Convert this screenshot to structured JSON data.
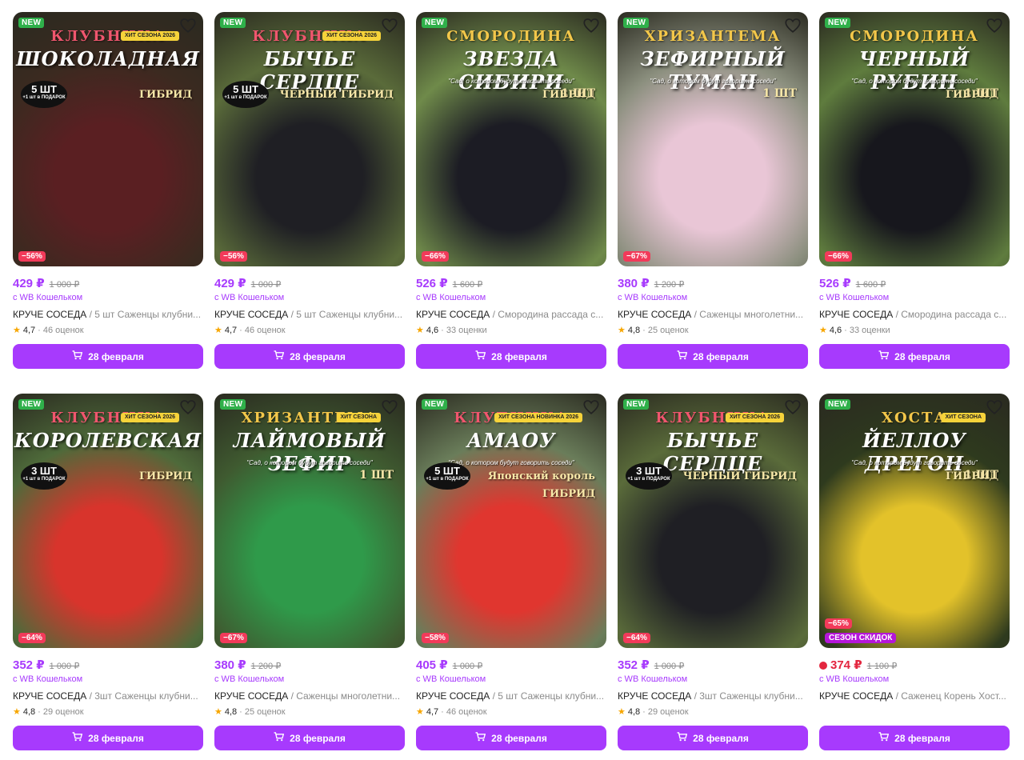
{
  "products": [
    {
      "new": "NEW",
      "cover_cat": "КЛУБНИКА",
      "cover_name": "ШОКОЛАДНАЯ",
      "cover_sub": "ГИБРИД",
      "cover_qty": "5 ШТ",
      "cover_qty_small": "+1 шт в ПОДАРОК",
      "cover_hit": "ХИТ СЕЗОНА 2026",
      "discount": "−56%",
      "price": "429 ₽",
      "old_price": "1 000 ₽",
      "wallet": "с WB Кошельком",
      "brand": "КРУЧЕ СОСЕДА",
      "name": " / 5 шт Саженцы клубни...",
      "rating": "4,7",
      "reviews": "· 46 оценок",
      "button": "28 февраля",
      "bg": "#3b2a20",
      "accent": "#5a1f22"
    },
    {
      "new": "NEW",
      "cover_cat": "КЛУБНИКА",
      "cover_name": "БЫЧЬЕ СЕРДЦЕ",
      "cover_sub": "ЧЕРНЫЙ ГИБРИД",
      "cover_qty": "5 ШТ",
      "cover_qty_small": "+1 шт в ПОДАРОК",
      "cover_hit": "ХИТ СЕЗОНА 2026",
      "discount": "−56%",
      "price": "429 ₽",
      "old_price": "1 000 ₽",
      "wallet": "с WB Кошельком",
      "brand": "КРУЧЕ СОСЕДА",
      "name": " / 5 шт Саженцы клубни...",
      "rating": "4,7",
      "reviews": "· 46 оценок",
      "button": "28 февраля",
      "bg": "#5a6b3a",
      "accent": "#1f1f24"
    },
    {
      "new": "NEW",
      "cover_cat": "СМОРОДИНА",
      "cover_name": "ЗВЕЗДА СИБИРИ",
      "cover_sub": "ГИБРИД",
      "cover_tag": "\"Сад, о котором будут говорить соседи\"",
      "cover_one": "1 ШТ",
      "discount": "−66%",
      "price": "526 ₽",
      "old_price": "1 600 ₽",
      "wallet": "с WB Кошельком",
      "brand": "КРУЧЕ СОСЕДА",
      "name": " / Смородина рассада с...",
      "rating": "4,6",
      "reviews": "· 33 оценки",
      "button": "28 февраля",
      "bg": "#6f8a4a",
      "accent": "#1c1c24"
    },
    {
      "new": "NEW",
      "cover_cat": "ХРИЗАНТЕМА",
      "cover_name": "ЗЕФИРНЫЙ ТУМАН",
      "cover_tag": "\"Сад, о котором будут говорить соседи\"",
      "cover_one": "1 ШТ",
      "discount": "−67%",
      "price": "380 ₽",
      "old_price": "1 200 ₽",
      "wallet": "с WB Кошельком",
      "brand": "КРУЧЕ СОСЕДА",
      "name": " / Саженцы многолетни...",
      "rating": "4,8",
      "reviews": "· 25 оценок",
      "button": "28 февраля",
      "bg": "#8b8f7e",
      "accent": "#e9c6d6"
    },
    {
      "new": "NEW",
      "cover_cat": "СМОРОДИНА",
      "cover_name": "ЧЕРНЫЙ РУБИН",
      "cover_sub": "ГИБРИД",
      "cover_tag": "\"Сад, о котором будут говорить соседи\"",
      "cover_one": "1 ШТ",
      "discount": "−66%",
      "price": "526 ₽",
      "old_price": "1 600 ₽",
      "wallet": "с WB Кошельком",
      "brand": "КРУЧЕ СОСЕДА",
      "name": " / Смородина рассада с...",
      "rating": "4,6",
      "reviews": "· 33 оценки",
      "button": "28 февраля",
      "bg": "#5f7c3e",
      "accent": "#17171d"
    },
    {
      "new": "NEW",
      "cover_cat": "КЛУБНИКА",
      "cover_name": "КОРОЛЕВСКАЯ",
      "cover_sub": "ГИБРИД",
      "cover_qty": "3 ШТ",
      "cover_qty_small": "+1 шт в ПОДАРОК",
      "cover_hit": "ХИТ СЕЗОНА 2026",
      "discount": "−64%",
      "price": "352 ₽",
      "old_price": "1 000 ₽",
      "wallet": "с WB Кошельком",
      "brand": "КРУЧЕ СОСЕДА",
      "name": " / 3шт Саженцы клубни...",
      "rating": "4,8",
      "reviews": "· 29 оценок",
      "button": "28 февраля",
      "bg": "#4e6a3a",
      "accent": "#d8342c"
    },
    {
      "new": "NEW",
      "cover_cat": "ХРИЗАНТЕМА",
      "cover_name": "ЛАЙМОВЫЙ ЗЕФИР",
      "cover_hit": "ХИТ СЕЗОНА",
      "cover_tag": "\"Сад, о котором будут говорить соседи\"",
      "cover_one": "1 ШТ",
      "discount": "−67%",
      "price": "380 ₽",
      "old_price": "1 200 ₽",
      "wallet": "с WB Кошельком",
      "brand": "КРУЧЕ СОСЕДА",
      "name": " / Саженцы многолетни...",
      "rating": "4,8",
      "reviews": "· 25 оценок",
      "button": "28 февраля",
      "bg": "#3f5a30",
      "accent": "#2f9a4a"
    },
    {
      "new": "NEW",
      "cover_cat": "КЛУБНИКА",
      "cover_name": "АМАОУ",
      "cover_sub": "Японский король",
      "cover_sub2": "ГИБРИД",
      "cover_qty": "5 ШТ",
      "cover_qty_small": "+1 шт в ПОДАРОК",
      "cover_hit": "ХИТ СЕЗОНА НОВИНКА 2026",
      "cover_tag": "\"Сад, о котором будут говорить соседи\"",
      "discount": "−58%",
      "price": "405 ₽",
      "old_price": "1 000 ₽",
      "wallet": "с WB Кошельком",
      "brand": "КРУЧЕ СОСЕДА",
      "name": " / 5 шт Саженцы клубни...",
      "rating": "4,7",
      "reviews": "· 46 оценок",
      "button": "28 февраля",
      "bg": "#6a7d5a",
      "accent": "#e0362f"
    },
    {
      "new": "NEW",
      "cover_cat": "КЛУБНИКА",
      "cover_name": "БЫЧЬЕ СЕРДЦЕ",
      "cover_sub": "ЧЕРНЫЙ ГИБРИД",
      "cover_qty": "3 ШТ",
      "cover_qty_small": "+1 шт в ПОДАРОК",
      "cover_hit": "ХИТ СЕЗОНА 2026",
      "discount": "−64%",
      "price": "352 ₽",
      "old_price": "1 000 ₽",
      "wallet": "с WB Кошельком",
      "brand": "КРУЧЕ СОСЕДА",
      "name": " / 3шт Саженцы клубни...",
      "rating": "4,8",
      "reviews": "· 29 оценок",
      "button": "28 февраля",
      "bg": "#5a6b3a",
      "accent": "#1f1f24"
    },
    {
      "new": "NEW",
      "cover_cat": "ХОСТА",
      "cover_name": "ЙЕЛЛОУ ДРЕГОН",
      "cover_sub": "ГИБРИД",
      "cover_hit": "ХИТ СЕЗОНА",
      "cover_tag": "\"Сад, о котором будут говорить соседи\"",
      "cover_one": "1 ШТ",
      "discount": "−65%",
      "season": "СЕЗОН СКИДОК",
      "price": "374 ₽",
      "old_price": "1 100 ₽",
      "red_price": true,
      "wallet": "с WB Кошельком",
      "brand": "КРУЧЕ СОСЕДА",
      "name": " / Саженец Корень Хост...",
      "rating": "",
      "reviews": "",
      "button": "28 февраля",
      "bg": "#2e3a1e",
      "accent": "#e3c22a"
    }
  ]
}
